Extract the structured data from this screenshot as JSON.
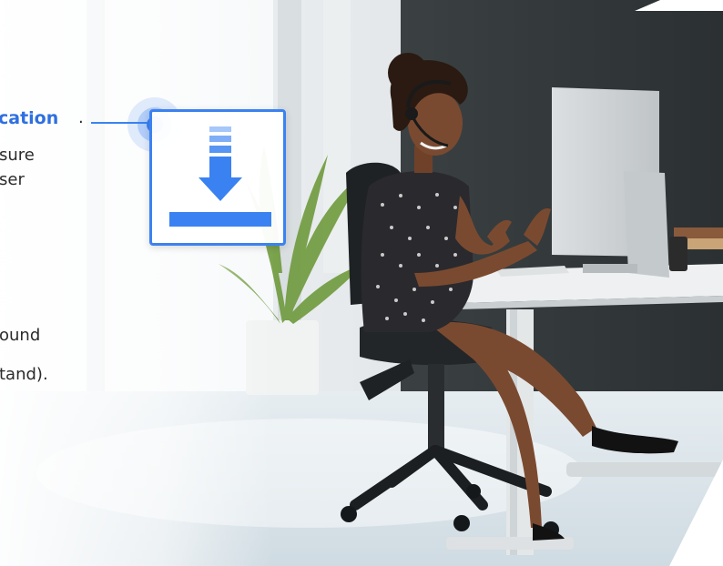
{
  "callout": {
    "highlight_text": "cation",
    "highlight_suffix": ".",
    "line_2": "sure",
    "line_3": "ser",
    "line_4": "ound",
    "line_5": "tand)."
  },
  "icons": {
    "download": "download-icon",
    "connector": "connector-dot-icon"
  },
  "colors": {
    "accent": "#3a82f1",
    "accent_light": "#bcd6fb",
    "text": "#2b2b2b"
  }
}
